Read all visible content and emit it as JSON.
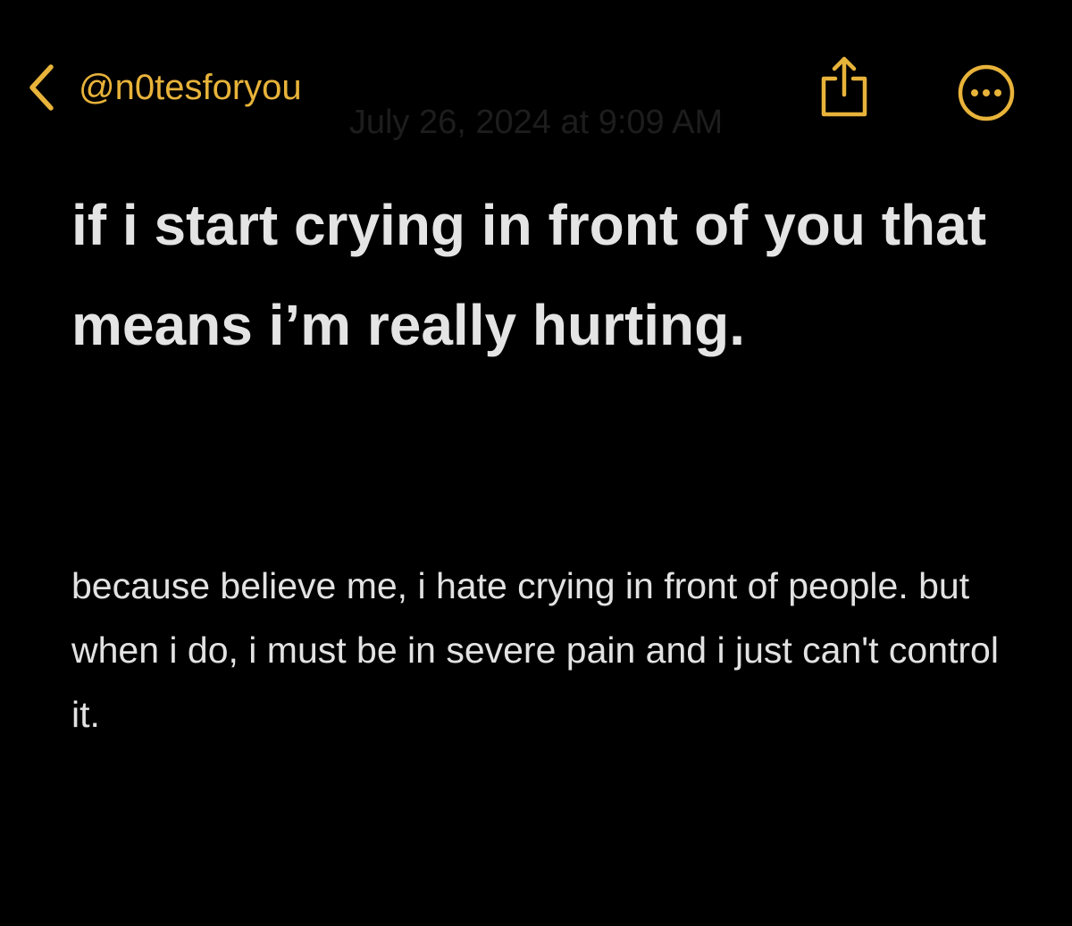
{
  "nav": {
    "back_label": "@n0tesforyou",
    "back_icon": "chevron-left-icon",
    "share_icon": "share-icon",
    "more_icon": "ellipsis-circle-icon"
  },
  "note": {
    "date": "July 26, 2024 at 9:09 AM",
    "title": "if i start crying in front of you that means i’m really hurting.",
    "body": "because believe me, i hate crying in front of people. but when i do, i must be in severe pain and i just can't control it."
  },
  "colors": {
    "accent": "#e8b33a",
    "background": "#000000",
    "text": "#e4e4e4",
    "date_text": "#1d1d1d"
  }
}
